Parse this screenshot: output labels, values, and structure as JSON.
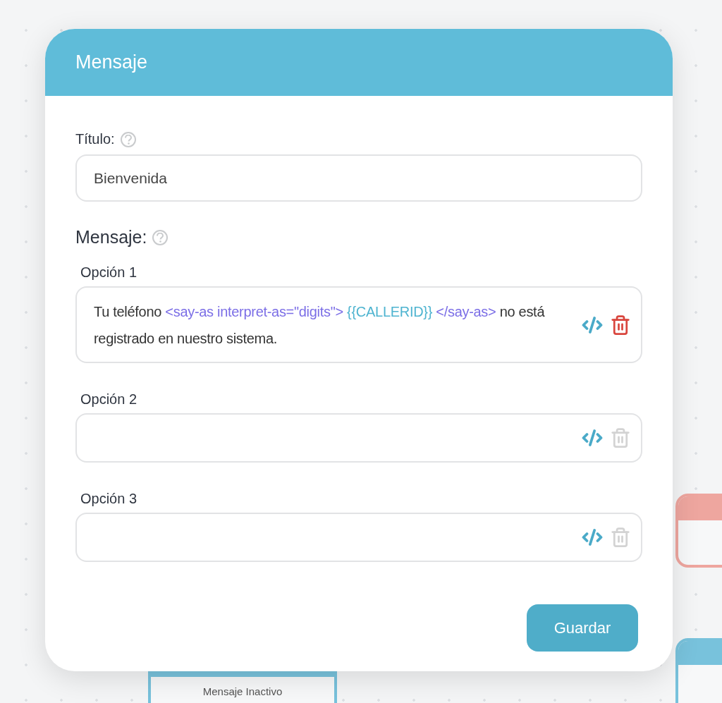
{
  "background_nodes": [
    {
      "color": "#eea69f"
    },
    {
      "color": "#78c2dc"
    },
    {
      "color": "#78c2dc",
      "label": "Mensaje Inactivo"
    }
  ],
  "dialog": {
    "title": "Mensaje",
    "title_field": {
      "label": "Título:",
      "value": "Bienvenida"
    },
    "message_label": "Mensaje:",
    "options": [
      {
        "label": "Opción 1",
        "segments": [
          {
            "kind": "text",
            "text": "Tu teléfono "
          },
          {
            "kind": "tag",
            "text": "<say-as interpret-as=\"digits\"> "
          },
          {
            "kind": "variable",
            "text": "{{CALLERID}} "
          },
          {
            "kind": "tag",
            "text": "</say-as>"
          },
          {
            "kind": "text",
            "text": " no está registrado en nuestro sistema."
          }
        ],
        "delete_disabled": false
      },
      {
        "label": "Opción 2",
        "delete_disabled": true
      },
      {
        "label": "Opción 3",
        "delete_disabled": true
      }
    ],
    "save_button": "Guardar"
  }
}
